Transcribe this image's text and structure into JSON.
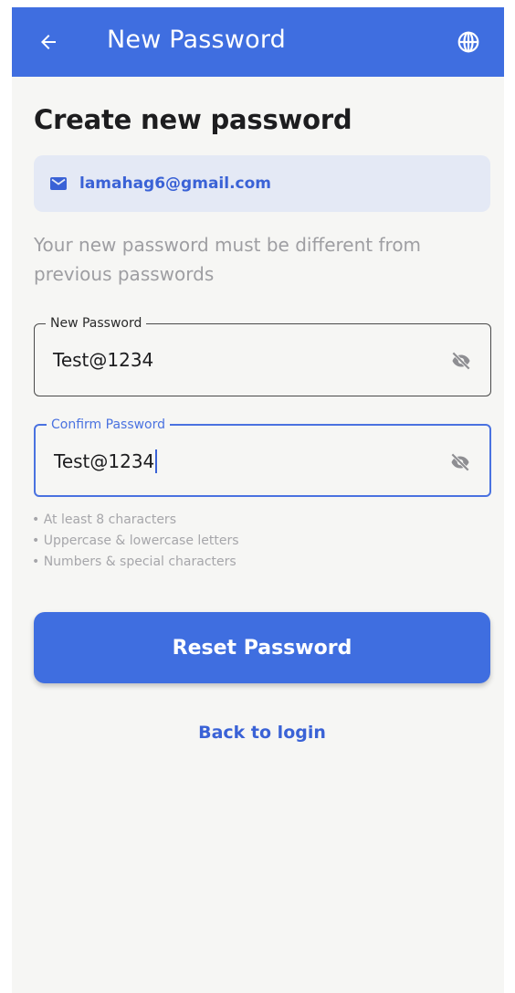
{
  "app_bar": {
    "title": "New Password",
    "back_icon": "arrow-left-icon",
    "language_icon": "globe-icon",
    "color": "#3f6ee0"
  },
  "heading": "Create new password",
  "email_chip": {
    "icon": "mail-icon",
    "email": "lamahag6@gmail.com"
  },
  "hint": "Your new password must be different from previous passwords",
  "fields": [
    {
      "label": "New Password",
      "value": "Test@1234",
      "icon": "eye-off-icon",
      "focused": false
    },
    {
      "label": "Confirm Password",
      "value": "Test@1234",
      "icon": "eye-off-icon",
      "focused": true
    }
  ],
  "requirements": [
    "• At least 8 characters",
    "• Uppercase & lowercase letters",
    "• Numbers & special characters"
  ],
  "primary_button": {
    "label": "Reset Password",
    "color": "#3f6ee0"
  },
  "back_link": "Back to login"
}
